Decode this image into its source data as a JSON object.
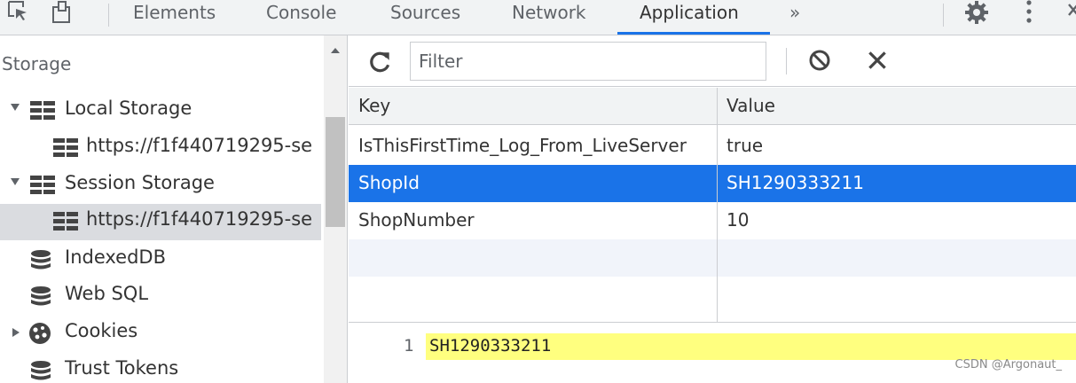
{
  "tabs": {
    "elements": "Elements",
    "console": "Console",
    "sources": "Sources",
    "network": "Network",
    "application": "Application",
    "more": "»"
  },
  "sidebar": {
    "title": "Storage",
    "items": [
      {
        "label": "Local Storage",
        "icon": "grid-storage-icon"
      },
      {
        "label": "https://f1f440719295-se",
        "icon": "grid-storage-icon"
      },
      {
        "label": "Session Storage",
        "icon": "grid-storage-icon"
      },
      {
        "label": "https://f1f440719295-se",
        "icon": "grid-storage-icon"
      },
      {
        "label": "IndexedDB",
        "icon": "database-icon"
      },
      {
        "label": "Web SQL",
        "icon": "database-icon"
      },
      {
        "label": "Cookies",
        "icon": "cookie-icon"
      },
      {
        "label": "Trust Tokens",
        "icon": "database-icon"
      }
    ]
  },
  "toolbar": {
    "filter_placeholder": "Filter"
  },
  "table": {
    "headers": {
      "key": "Key",
      "value": "Value"
    },
    "rows": [
      {
        "key": "IsThisFirstTime_Log_From_LiveServer",
        "value": "true"
      },
      {
        "key": "ShopId",
        "value": "SH1290333211"
      },
      {
        "key": "ShopNumber",
        "value": "10"
      }
    ]
  },
  "preview": {
    "line_number": "1",
    "content": "SH1290333211"
  },
  "watermark": "CSDN @Argonaut_",
  "colors": {
    "accent": "#1a73e8",
    "selected_row": "#1a73e8",
    "highlight": "#ffff7f"
  }
}
